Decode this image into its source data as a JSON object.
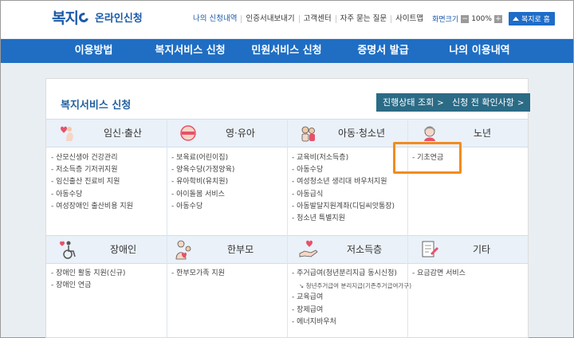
{
  "header": {
    "logo_text": "복지",
    "logo_sub": "온라인신청",
    "util_links": [
      "나의 신청내역",
      "인증서내보내기",
      "고객센터",
      "자주 묻는 질문",
      "사이트맵"
    ],
    "zoom_label": "화면크기",
    "zoom_minus": "−",
    "zoom_value": "100%",
    "zoom_plus": "+",
    "home_label": "복지로 홈"
  },
  "nav": [
    "이용방법",
    "복지서비스 신청",
    "민원서비스 신청",
    "증명서 발급",
    "나의 이용내역"
  ],
  "panel": {
    "title": "복지서비스 신청",
    "btn_status": "진행상태 조회",
    "btn_check": "신청 전 확인사항",
    "chevron": ">"
  },
  "categories": [
    {
      "label": "임신·출산",
      "icon": "pregnancy-icon",
      "items": [
        "산모신생아 건강관리",
        "저소득층 기저귀지원",
        "임신출산 진료비 지원",
        "아동수당",
        "여성장애인 출산비용 지원"
      ]
    },
    {
      "label": "영·유아",
      "icon": "baby-icon",
      "items": [
        "보육료(어린이집)",
        "양육수당(가정양육)",
        "유아학비(유치원)",
        "아이돌봄 서비스",
        "아동수당"
      ]
    },
    {
      "label": "아동·청소년",
      "icon": "children-icon",
      "items": [
        "교육비(저소득층)",
        "아동수당",
        "여성청소년 생리대 바우처지원",
        "아동급식",
        "아동발달지원계좌(디딤씨앗통장)",
        "청소년 특별지원"
      ]
    },
    {
      "label": "노년",
      "icon": "elderly-icon",
      "items": [
        "기초연금"
      ]
    },
    {
      "label": "장애인",
      "icon": "wheelchair-icon",
      "items": [
        "장애인 활동 지원(신규)",
        "장애인 연금"
      ]
    },
    {
      "label": "한부모",
      "icon": "single-parent-icon",
      "items": [
        "한부모가족 지원"
      ]
    },
    {
      "label": "저소득층",
      "icon": "low-income-icon",
      "items": [
        "주거급여(청년분리지급 동시신청)",
        "교육급여",
        "장제급여",
        "에너지바우처"
      ],
      "sub_item": "청년주거급여 분리지급(기존주거급여가구)"
    },
    {
      "label": "기타",
      "icon": "document-icon",
      "items": [
        "요금감면 서비스"
      ]
    }
  ],
  "colors": {
    "nav": "#1f6ec3",
    "header_bg": "#eaf1f8",
    "button": "#2b6b86",
    "highlight": "#f28c1f"
  }
}
